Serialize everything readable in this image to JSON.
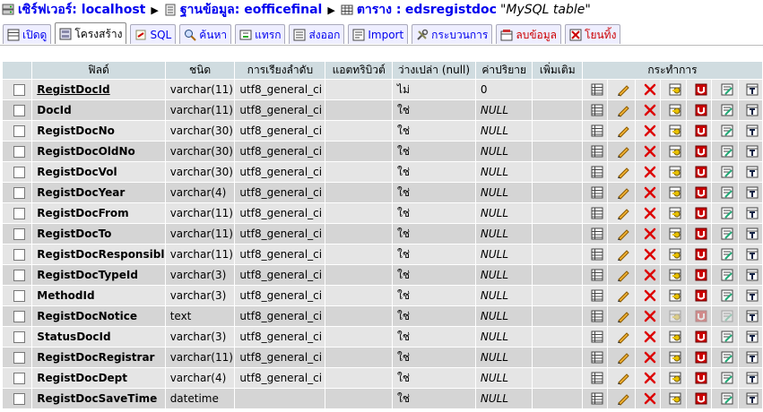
{
  "breadcrumb": {
    "server_label": "เซิร์ฟเวอร์: localhost",
    "db_label": "ฐานข้อมูล: eofficefinal",
    "table_prefix": "ตาราง :",
    "table_name": "edsregistdoc",
    "table_desc": "\"MySQL table\""
  },
  "tabs": [
    {
      "label": "เปิดดู",
      "icon": "browse-icon"
    },
    {
      "label": "โครงสร้าง",
      "icon": "structure-icon"
    },
    {
      "label": "SQL",
      "icon": "sql-icon"
    },
    {
      "label": "ค้นหา",
      "icon": "search-icon"
    },
    {
      "label": "แทรก",
      "icon": "insert-icon"
    },
    {
      "label": "ส่งออก",
      "icon": "export-icon"
    },
    {
      "label": "Import",
      "icon": "import-icon"
    },
    {
      "label": "กระบวนการ",
      "icon": "operations-icon"
    },
    {
      "label": "ลบข้อมูล",
      "icon": "empty-icon"
    },
    {
      "label": "โยนทิ้ง",
      "icon": "drop-icon"
    }
  ],
  "columns": [
    "ฟิลด์",
    "ชนิด",
    "การเรียงลำดับ",
    "แอตทริบิวต์",
    "ว่างเปล่า (null)",
    "ค่าปริยาย",
    "เพิ่มเติม",
    "กระทำการ"
  ],
  "rows": [
    {
      "field": "RegistDocId",
      "type": "varchar(11)",
      "collation": "utf8_general_ci",
      "attr": "",
      "null": "ไม่",
      "default": "0",
      "extra": "",
      "pk": true
    },
    {
      "field": "DocId",
      "type": "varchar(11)",
      "collation": "utf8_general_ci",
      "attr": "",
      "null": "ใช่",
      "default": "NULL",
      "extra": ""
    },
    {
      "field": "RegistDocNo",
      "type": "varchar(30)",
      "collation": "utf8_general_ci",
      "attr": "",
      "null": "ใช่",
      "default": "NULL",
      "extra": ""
    },
    {
      "field": "RegistDocOldNo",
      "type": "varchar(30)",
      "collation": "utf8_general_ci",
      "attr": "",
      "null": "ใช่",
      "default": "NULL",
      "extra": ""
    },
    {
      "field": "RegistDocVol",
      "type": "varchar(30)",
      "collation": "utf8_general_ci",
      "attr": "",
      "null": "ใช่",
      "default": "NULL",
      "extra": ""
    },
    {
      "field": "RegistDocYear",
      "type": "varchar(4)",
      "collation": "utf8_general_ci",
      "attr": "",
      "null": "ใช่",
      "default": "NULL",
      "extra": ""
    },
    {
      "field": "RegistDocFrom",
      "type": "varchar(11)",
      "collation": "utf8_general_ci",
      "attr": "",
      "null": "ใช่",
      "default": "NULL",
      "extra": ""
    },
    {
      "field": "RegistDocTo",
      "type": "varchar(11)",
      "collation": "utf8_general_ci",
      "attr": "",
      "null": "ใช่",
      "default": "NULL",
      "extra": ""
    },
    {
      "field": "RegistDocResponsibler",
      "type": "varchar(11)",
      "collation": "utf8_general_ci",
      "attr": "",
      "null": "ใช่",
      "default": "NULL",
      "extra": ""
    },
    {
      "field": "RegistDocTypeId",
      "type": "varchar(3)",
      "collation": "utf8_general_ci",
      "attr": "",
      "null": "ใช่",
      "default": "NULL",
      "extra": ""
    },
    {
      "field": "MethodId",
      "type": "varchar(3)",
      "collation": "utf8_general_ci",
      "attr": "",
      "null": "ใช่",
      "default": "NULL",
      "extra": ""
    },
    {
      "field": "RegistDocNotice",
      "type": "text",
      "collation": "utf8_general_ci",
      "attr": "",
      "null": "ใช่",
      "default": "NULL",
      "extra": "",
      "text_type": true
    },
    {
      "field": "StatusDocId",
      "type": "varchar(3)",
      "collation": "utf8_general_ci",
      "attr": "",
      "null": "ใช่",
      "default": "NULL",
      "extra": ""
    },
    {
      "field": "RegistDocRegistrar",
      "type": "varchar(11)",
      "collation": "utf8_general_ci",
      "attr": "",
      "null": "ใช่",
      "default": "NULL",
      "extra": ""
    },
    {
      "field": "RegistDocDept",
      "type": "varchar(4)",
      "collation": "utf8_general_ci",
      "attr": "",
      "null": "ใช่",
      "default": "NULL",
      "extra": ""
    },
    {
      "field": "RegistDocSaveTime",
      "type": "datetime",
      "collation": "",
      "attr": "",
      "null": "ใช่",
      "default": "NULL",
      "extra": ""
    }
  ],
  "row_actions": [
    "browse-distinct-icon",
    "edit-icon",
    "delete-icon",
    "primary-key-icon",
    "unique-icon",
    "index-icon",
    "fulltext-icon"
  ],
  "colors": {
    "header_bg": "#d0dce0",
    "row_odd": "#e5e5e5",
    "row_even": "#d5d5d5",
    "link": "#0000ee",
    "danger": "#cc0000"
  }
}
